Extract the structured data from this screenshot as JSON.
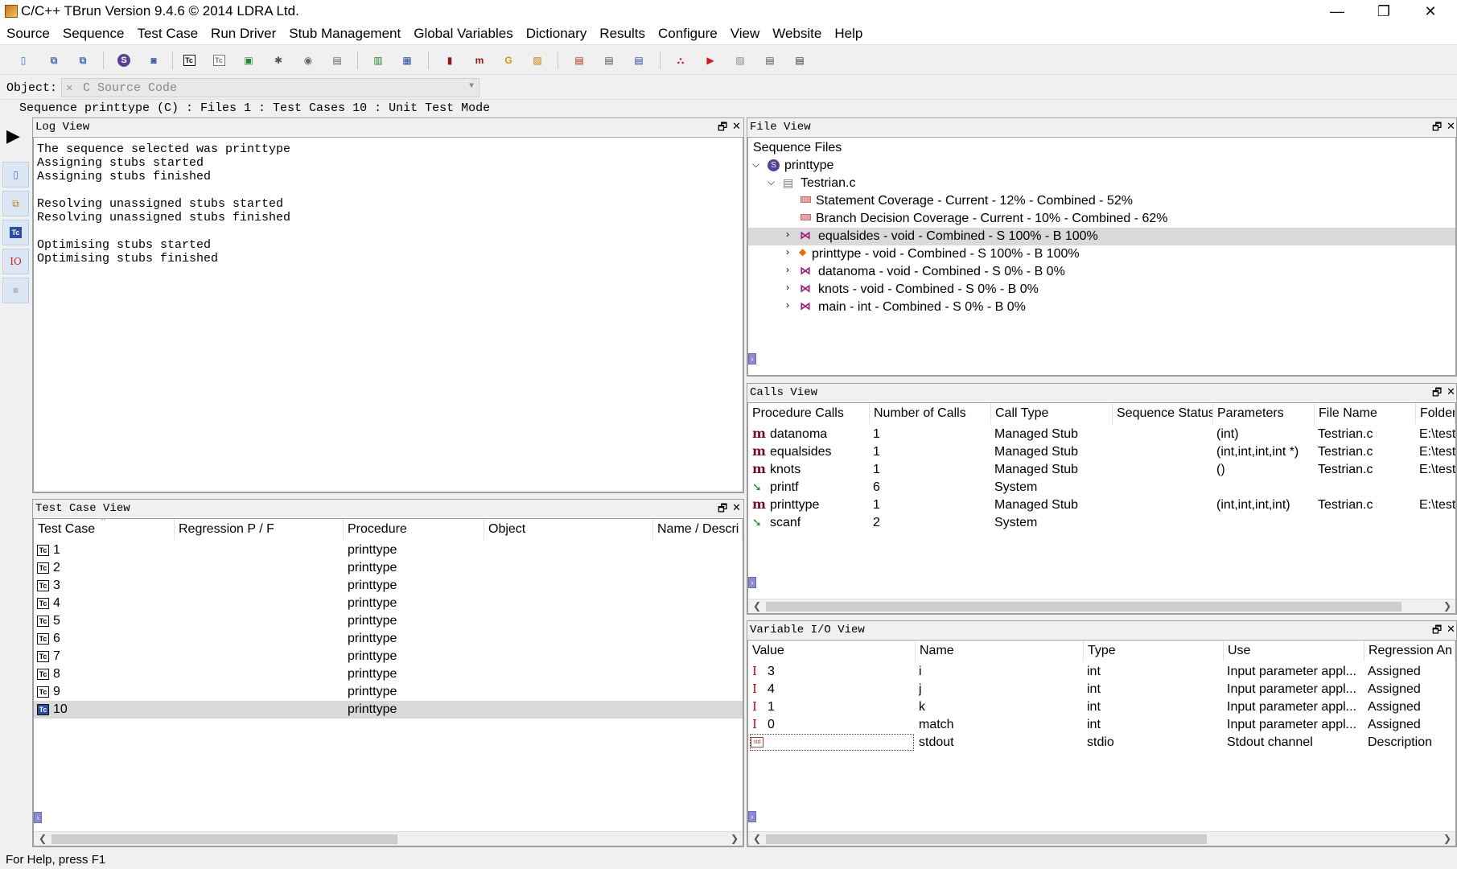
{
  "window": {
    "title": "C/C++ TBrun Version 9.4.6 © 2014 LDRA Ltd.",
    "minimize": "—",
    "maximize": "❐",
    "close": "✕"
  },
  "menu": [
    "Source",
    "Sequence",
    "Test Case",
    "Run Driver",
    "Stub Management",
    "Global Variables",
    "Dictionary",
    "Results",
    "Configure",
    "View",
    "Website",
    "Help"
  ],
  "object": {
    "label": "Object:",
    "value": "C Source Code"
  },
  "sequence_line": "Sequence printtype (C) : Files 1 : Test Cases 10 : Unit Test Mode",
  "log_view": {
    "title": "Log View",
    "lines": [
      "The sequence selected was printtype",
      "Assigning stubs started",
      "Assigning stubs finished",
      "",
      "Resolving unassigned stubs started",
      "Resolving unassigned stubs finished",
      "",
      "Optimising stubs started",
      "Optimising stubs finished"
    ]
  },
  "test_case_view": {
    "title": "Test Case View",
    "columns": [
      "Test Case",
      "Regression P / F",
      "Procedure",
      "Object",
      "Name / Descri"
    ],
    "rows": [
      {
        "id": "1",
        "procedure": "printtype"
      },
      {
        "id": "2",
        "procedure": "printtype"
      },
      {
        "id": "3",
        "procedure": "printtype"
      },
      {
        "id": "4",
        "procedure": "printtype"
      },
      {
        "id": "5",
        "procedure": "printtype"
      },
      {
        "id": "6",
        "procedure": "printtype"
      },
      {
        "id": "7",
        "procedure": "printtype"
      },
      {
        "id": "8",
        "procedure": "printtype"
      },
      {
        "id": "9",
        "procedure": "printtype"
      },
      {
        "id": "10",
        "procedure": "printtype"
      }
    ],
    "selected_row": 9
  },
  "file_view": {
    "title": "File View",
    "root_label": "Sequence Files",
    "sequence": "printtype",
    "file": "Testrian.c",
    "coverage": [
      "Statement Coverage - Current - 12% - Combined - 52%",
      "Branch Decision Coverage - Current - 10% - Combined - 62%"
    ],
    "procedures": [
      "equalsides - void - Combined - S 100% - B 100%",
      "printtype - void - Combined - S 100% - B 100%",
      "datanoma - void - Combined - S 0% - B 0%",
      "knots - void - Combined - S 0% - B 0%",
      "main - int - Combined - S 0% - B 0%"
    ]
  },
  "calls_view": {
    "title": "Calls View",
    "columns": [
      "Procedure Calls",
      "Number of Calls",
      "Call Type",
      "Sequence Status",
      "Parameters",
      "File Name",
      "Folder"
    ],
    "rows": [
      {
        "icon": "managed-stub-icon",
        "name": "datanoma",
        "calls": "1",
        "type": "Managed Stub",
        "status": "",
        "params": "(int)",
        "file": "Testrian.c",
        "folder": "E:\\test"
      },
      {
        "icon": "managed-stub-icon",
        "name": "equalsides",
        "calls": "1",
        "type": "Managed Stub",
        "status": "",
        "params": "(int,int,int,int *)",
        "file": "Testrian.c",
        "folder": "E:\\test"
      },
      {
        "icon": "managed-stub-icon",
        "name": "knots",
        "calls": "1",
        "type": "Managed Stub",
        "status": "",
        "params": "()",
        "file": "Testrian.c",
        "folder": "E:\\test"
      },
      {
        "icon": "system-icon",
        "name": "printf",
        "calls": "6",
        "type": "System",
        "status": "",
        "params": "",
        "file": "",
        "folder": ""
      },
      {
        "icon": "managed-stub-icon",
        "name": "printtype",
        "calls": "1",
        "type": "Managed Stub",
        "status": "",
        "params": "(int,int,int,int)",
        "file": "Testrian.c",
        "folder": "E:\\test"
      },
      {
        "icon": "system-icon",
        "name": "scanf",
        "calls": "2",
        "type": "System",
        "status": "",
        "params": "",
        "file": "",
        "folder": ""
      }
    ]
  },
  "variable_io_view": {
    "title": "Variable I/O View",
    "columns": [
      "Value",
      "Name",
      "Type",
      "Use",
      "Regression An"
    ],
    "rows": [
      {
        "io": "I",
        "value": "3",
        "name": "i",
        "type": "int",
        "use": "Input parameter appl...",
        "reg": "Assigned"
      },
      {
        "io": "I",
        "value": "4",
        "name": "j",
        "type": "int",
        "use": "Input parameter appl...",
        "reg": "Assigned"
      },
      {
        "io": "I",
        "value": "1",
        "name": "k",
        "type": "int",
        "use": "Input parameter appl...",
        "reg": "Assigned"
      },
      {
        "io": "I",
        "value": "0",
        "name": "match",
        "type": "int",
        "use": "Input parameter appl...",
        "reg": "Assigned"
      },
      {
        "io": "",
        "value": "",
        "name": "stdout",
        "type": "stdio",
        "use": "Stdout channel",
        "reg": "Description"
      }
    ]
  },
  "status_bar": "For Help, press F1",
  "colors": {
    "selection": "#d9d9d9",
    "managed_stub": "#7a0a2a",
    "system": "#168a1a",
    "io_input": "#c80000"
  }
}
